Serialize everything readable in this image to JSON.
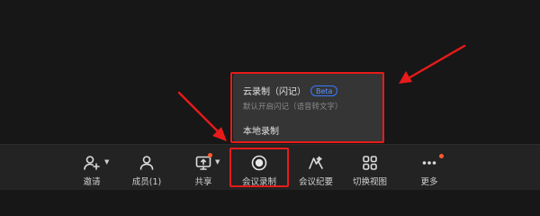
{
  "toolbar": {
    "items": [
      {
        "label": "邀请",
        "icon": "add-user-icon"
      },
      {
        "label": "成员(1)",
        "icon": "members-icon"
      },
      {
        "label": "共享",
        "icon": "screen-share-icon"
      },
      {
        "label": "会议录制",
        "icon": "record-icon"
      },
      {
        "label": "会议纪要",
        "icon": "minutes-icon"
      },
      {
        "label": "切换视图",
        "icon": "grid-view-icon"
      },
      {
        "label": "更多",
        "icon": "more-icon"
      }
    ]
  },
  "record_menu": {
    "cloud": {
      "title": "云录制（闪记）",
      "badge": "Beta",
      "subtitle": "默认开启闪记（语音转文字）"
    },
    "local": {
      "title": "本地录制"
    }
  },
  "colors": {
    "background": "#171717",
    "toolbar": "#232323",
    "popup": "#353535",
    "annotation_red": "#e81a1a",
    "badge_blue": "#3a79ff",
    "notification_dot": "#ff5a2e"
  }
}
